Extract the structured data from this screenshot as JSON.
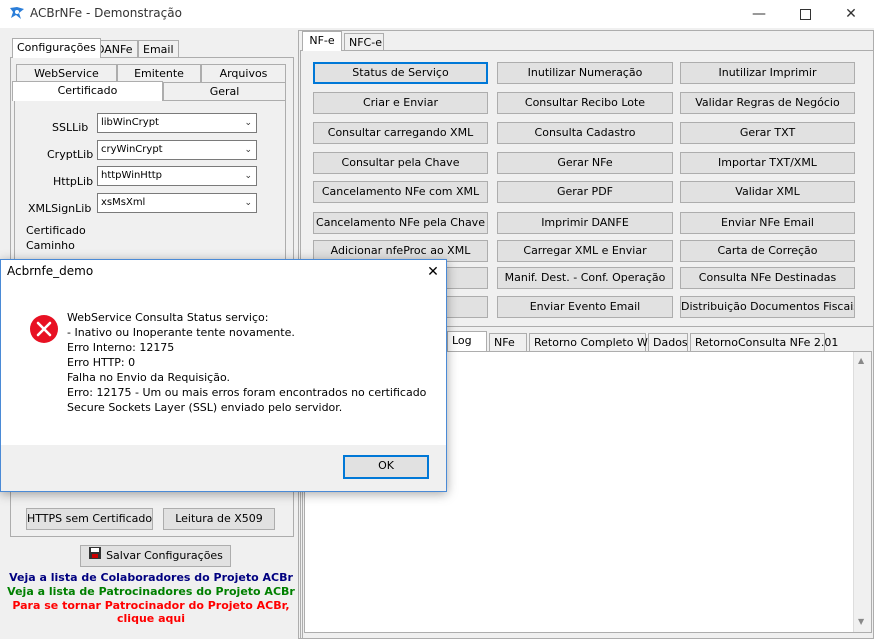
{
  "window": {
    "title": "ACBrNFe - Demonstração"
  },
  "left": {
    "tabs": [
      "Configurações",
      "DANFe",
      "Email"
    ],
    "subtabs_row1": [
      "WebService",
      "Emitente",
      "Arquivos"
    ],
    "subtabs_row2": [
      "Certificado",
      "Geral"
    ],
    "libs": [
      {
        "label": "SSLLib",
        "value": "libWinCrypt"
      },
      {
        "label": "CryptLib",
        "value": "cryWinCrypt"
      },
      {
        "label": "HttpLib",
        "value": "httpWinHttp"
      },
      {
        "label": "XMLSignLib",
        "value": "xsMsXml"
      }
    ],
    "cert_group": "Certificado",
    "caminho": "Caminho",
    "btn_https": "HTTPS sem Certificado",
    "btn_x509": "Leitura de X509",
    "btn_save": "Salvar Configurações",
    "links": [
      {
        "text": "Veja a lista de Colaboradores do Projeto ACBr",
        "color": "#000080"
      },
      {
        "text": "Veja a lista de Patrocinadores do Projeto ACBr",
        "color": "#008000"
      },
      {
        "text": "Para se tornar Patrocinador do Projeto ACBr,",
        "color": "#ff0000"
      },
      {
        "text": "clique aqui",
        "color": "#ff0000"
      }
    ]
  },
  "right": {
    "tabs": [
      "NF-e",
      "NFC-e"
    ],
    "buttons": [
      [
        "Status de Serviço",
        "Inutilizar Numeração",
        "Inutilizar Imprimir"
      ],
      [
        "Criar e Enviar",
        "Consultar Recibo Lote",
        "Validar Regras de Negócio"
      ],
      [
        "Consultar carregando XML",
        "Consulta Cadastro",
        "Gerar TXT"
      ],
      [
        "Consultar pela Chave",
        "Gerar NFe",
        "Importar TXT/XML"
      ],
      [
        "Cancelamento NFe com XML",
        "Gerar PDF",
        "Validar XML"
      ],
      [
        "Cancelamento NFe pela Chave",
        "Imprimir DANFE",
        "Enviar NFe Email"
      ],
      [
        "Adicionar nfeProc ao XML",
        "Carregar XML e Enviar",
        "Carta de Correção"
      ],
      [
        "",
        "Manif. Dest. - Conf. Operação",
        "Consulta NFe Destinadas"
      ],
      [
        "",
        "Enviar Evento Email",
        "Distribuição Documentos Fiscais"
      ]
    ],
    "result_tabs": [
      "Log",
      "NFe",
      "Retorno Completo WS",
      "Dados",
      "RetornoConsulta NFe 2.01"
    ]
  },
  "dialog": {
    "title": "Acbrnfe_demo",
    "lines": [
      "WebService Consulta Status serviço:",
      "- Inativo ou Inoperante tente novamente.",
      "Erro Interno: 12175",
      "Erro HTTP: 0",
      "Falha no Envio da Requisição.",
      "Erro: 12175 - Um ou mais erros foram encontrados no certificado",
      "Secure Sockets Layer (SSL) enviado pelo servidor."
    ],
    "ok": "OK"
  },
  "colors": {
    "accent": "#0078d7",
    "error": "#e81123"
  },
  "icons": {
    "app": "acbr-logo-icon",
    "error": "error-icon",
    "save": "save-icon"
  }
}
